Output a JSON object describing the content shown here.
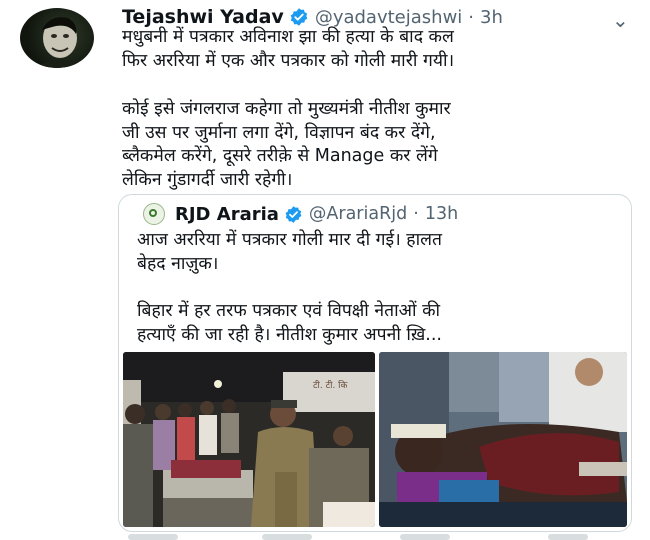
{
  "tweet": {
    "author_name": "Tejashwi Yadav",
    "handle": "@yadavtejashwi",
    "separator": "·",
    "time": "3h",
    "more_icon": "⌄",
    "verified_color": "#1d9bf0",
    "text_lines_1": [
      "मधुबनी में पत्रकार अविनाश झा की हत्या के बाद कल",
      "फिर अररिया में एक और पत्रकार को गोली मारी गयी।"
    ],
    "text_lines_2": [
      "कोई इसे जंगलराज कहेगा तो मुख्यमंत्री नीतीश कुमार",
      "जी उस पर जुर्माना लगा देंगे, विज्ञापन बंद कर देंगे,",
      "ब्लैकमेल करेंगे, दूसरे तरीक़े से Manage कर लेंगे",
      "लेकिन गुंडागर्दी जारी रहेगी।"
    ]
  },
  "quoted": {
    "author_name": "RJD Araria",
    "handle": "@ArariaRjd",
    "separator": "·",
    "time": "13h",
    "text_lines_1": [
      "आज अररिया में पत्रकार गोली मार दी गई। हालत",
      "बेहद नाज़ुक।"
    ],
    "text_lines_2": [
      "बिहार में हर तरफ पत्रकार एवं विपक्षी नेताओं की",
      "हत्याएँ की जा रही है। नीतीश कुमार अपनी ख़ि..."
    ],
    "photo_left_sign": "टी. टी. कि",
    "photos": [
      "police-officer-at-hospital-photo",
      "injured-journalist-photo"
    ]
  }
}
